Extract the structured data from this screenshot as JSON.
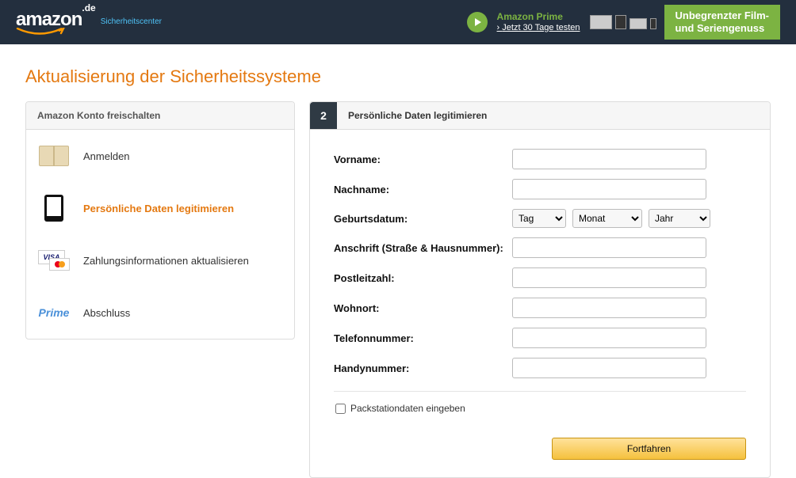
{
  "header": {
    "brand": "amazon",
    "tld": ".de",
    "sub_brand": "Sicherheitscenter",
    "prime_title": "Amazon Prime",
    "prime_sub": "Jetzt 30 Tage testen",
    "banner_line1": "Unbegrenzter Film-",
    "banner_line2": "und Seriengenuss"
  },
  "page": {
    "title": "Aktualisierung der Sicherheitssysteme"
  },
  "sidebar": {
    "header": "Amazon Konto freischalten",
    "items": [
      {
        "label": "Anmelden"
      },
      {
        "label": "Persönliche Daten legitimieren"
      },
      {
        "label": "Zahlungsinformationen aktualisieren"
      },
      {
        "label": "Abschluss"
      }
    ],
    "prime_word": "Prime",
    "visa_word": "VISA"
  },
  "step": {
    "number": "2",
    "title": "Persönliche Daten legitimieren"
  },
  "form": {
    "vorname": "Vorname:",
    "nachname": "Nachname:",
    "geburt": "Geburtsdatum:",
    "anschrift": "Anschrift (Straße & Hausnummer):",
    "plz": "Postleitzahl:",
    "wohnort": "Wohnort:",
    "telefon": "Telefonnummer:",
    "handy": "Handynummer:",
    "tag": "Tag",
    "monat": "Monat",
    "jahr": "Jahr",
    "packstation": "Packstationdaten eingeben",
    "continue": "Fortfahren"
  }
}
